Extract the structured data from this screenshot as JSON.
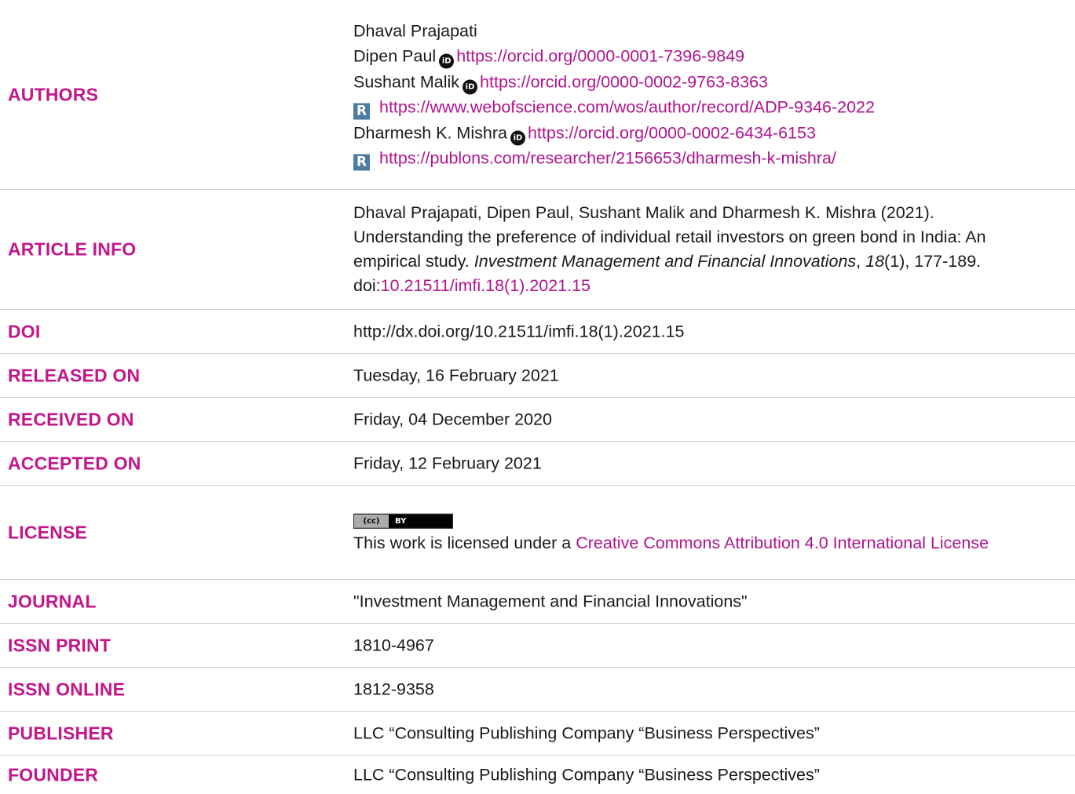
{
  "labels": {
    "authors": "AUTHORS",
    "article_info": "ARTICLE INFO",
    "doi": "DOI",
    "released_on": "RELEASED ON",
    "received_on": "RECEIVED ON",
    "accepted_on": "ACCEPTED ON",
    "license": "LICENSE",
    "journal": "JOURNAL",
    "issn_print": "ISSN PRINT",
    "issn_online": "ISSN ONLINE",
    "publisher": "PUBLISHER",
    "founder": "FOUNDER"
  },
  "authors": [
    {
      "name": "Dhaval Prajapati"
    },
    {
      "name": "Dipen Paul",
      "orcid": "https://orcid.org/0000-0001-7396-9849"
    },
    {
      "name": "Sushant Malik",
      "orcid": "https://orcid.org/0000-0002-9763-8363",
      "researcher_id": "https://www.webofscience.com/wos/author/record/ADP-9346-2022"
    },
    {
      "name": "Dharmesh K. Mishra",
      "orcid": "https://orcid.org/0000-0002-6434-6153",
      "researcher_id": "https://publons.com/researcher/2156653/dharmesh-k-mishra/"
    }
  ],
  "article_info": {
    "citation_pre": "Dhaval Prajapati, Dipen Paul, Sushant Malik and Dharmesh K. Mishra (2021). Understanding the preference of individual retail investors on green bond in India: An empirical study. ",
    "journal_italic": "Investment Management and Financial Innovations",
    "comma": ", ",
    "volume_italic": "18",
    "citation_post": "(1), 177-189. doi:",
    "doi_link": "10.21511/imfi.18(1).2021.15"
  },
  "doi": "http://dx.doi.org/10.21511/imfi.18(1).2021.15",
  "released_on": "Tuesday, 16 February 2021",
  "received_on": "Friday, 04 December 2020",
  "accepted_on": "Friday, 12 February 2021",
  "license": {
    "badge_left": "(cc)",
    "badge_right": "BY",
    "text_pre": "This work is licensed under a ",
    "link": "Creative Commons Attribution 4.0 International License"
  },
  "journal": "\"Investment Management and Financial Innovations\"",
  "issn_print": "1810-4967",
  "issn_online": "1812-9358",
  "publisher": "LLC “Consulting Publishing Company “Business Perspectives”",
  "founder": "LLC “Consulting Publishing Company “Business Perspectives”",
  "icons": {
    "orcid_glyph": "iD",
    "researcher_glyph": "R"
  },
  "colors": {
    "accent": "#c2168b",
    "link": "#b0148e",
    "rid": "#4d7ca3"
  }
}
